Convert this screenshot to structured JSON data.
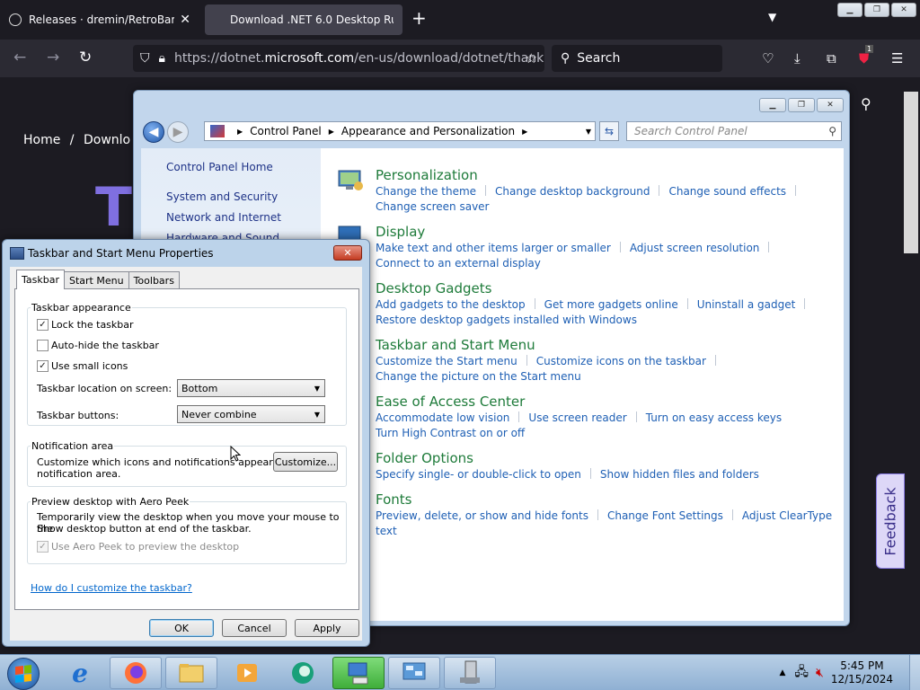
{
  "browser": {
    "tabs": [
      {
        "title": "Releases · dremin/RetroBar",
        "active": false
      },
      {
        "title": "Download .NET 6.0 Desktop Runtime",
        "active": true
      }
    ],
    "url_prefix": "https://dotnet.",
    "url_domain": "microsoft.com",
    "url_rest": "/en-us/download/dotnet/thank",
    "search_placeholder": "Search",
    "extension_badge": "1"
  },
  "webpage": {
    "breadcrumb_home": "Home",
    "breadcrumb_sep": "/",
    "breadcrumb_next": "Downlo",
    "heading_fragment": "T",
    "feedback_label": "Feedback"
  },
  "control_panel": {
    "breadcrumb": [
      "Control Panel",
      "Appearance and Personalization"
    ],
    "search_placeholder": "Search Control Panel",
    "left_links": [
      "Control Panel Home",
      "System and Security",
      "Network and Internet",
      "Hardware and Sound"
    ],
    "categories": [
      {
        "title": "Personalization",
        "lines": [
          [
            "Change the theme",
            "Change desktop background",
            "Change sound effects"
          ],
          [
            "Change screen saver"
          ]
        ]
      },
      {
        "title": "Display",
        "lines": [
          [
            "Make text and other items larger or smaller",
            "Adjust screen resolution"
          ],
          [
            "Connect to an external display"
          ]
        ]
      },
      {
        "title": "Desktop Gadgets",
        "lines": [
          [
            "Add gadgets to the desktop",
            "Get more gadgets online",
            "Uninstall a gadget"
          ],
          [
            "Restore desktop gadgets installed with Windows"
          ]
        ]
      },
      {
        "title": "Taskbar and Start Menu",
        "lines": [
          [
            "Customize the Start menu",
            "Customize icons on the taskbar"
          ],
          [
            "Change the picture on the Start menu"
          ]
        ]
      },
      {
        "title": "Ease of Access Center",
        "lines": [
          [
            "Accommodate low vision",
            "Use screen reader",
            "Turn on easy access keys"
          ],
          [
            "Turn High Contrast on or off"
          ]
        ]
      },
      {
        "title": "Folder Options",
        "lines": [
          [
            "Specify single- or double-click to open",
            "Show hidden files and folders"
          ]
        ]
      },
      {
        "title": "Fonts",
        "lines": [
          [
            "Preview, delete, or show and hide fonts",
            "Change Font Settings",
            "Adjust ClearType text"
          ]
        ]
      }
    ]
  },
  "dialog": {
    "title": "Taskbar and Start Menu Properties",
    "close_label": "✕",
    "tabs": [
      "Taskbar",
      "Start Menu",
      "Toolbars"
    ],
    "appearance": {
      "group_title": "Taskbar appearance",
      "lock": {
        "label": "Lock the taskbar",
        "checked": true
      },
      "autohide": {
        "label": "Auto-hide the taskbar",
        "checked": false
      },
      "small_icons": {
        "label": "Use small icons",
        "checked": true
      },
      "location_label": "Taskbar location on screen:",
      "location_value": "Bottom",
      "buttons_label": "Taskbar buttons:",
      "buttons_value": "Never combine"
    },
    "notification": {
      "group_title": "Notification area",
      "text1": "Customize which icons and notifications appear in the",
      "text2": "notification area.",
      "customize_label": "Customize..."
    },
    "peek": {
      "group_title": "Preview desktop with Aero Peek",
      "text1": "Temporarily view the desktop when you move your mouse to the",
      "text2": "Show desktop button at end of the taskbar.",
      "checkbox_label": "Use Aero Peek to preview the desktop",
      "checked": true
    },
    "help_link": "How do I customize the taskbar?",
    "ok_label": "OK",
    "cancel_label": "Cancel",
    "apply_label": "Apply"
  },
  "taskbar": {
    "time": "5:45 PM",
    "date": "12/15/2024"
  }
}
